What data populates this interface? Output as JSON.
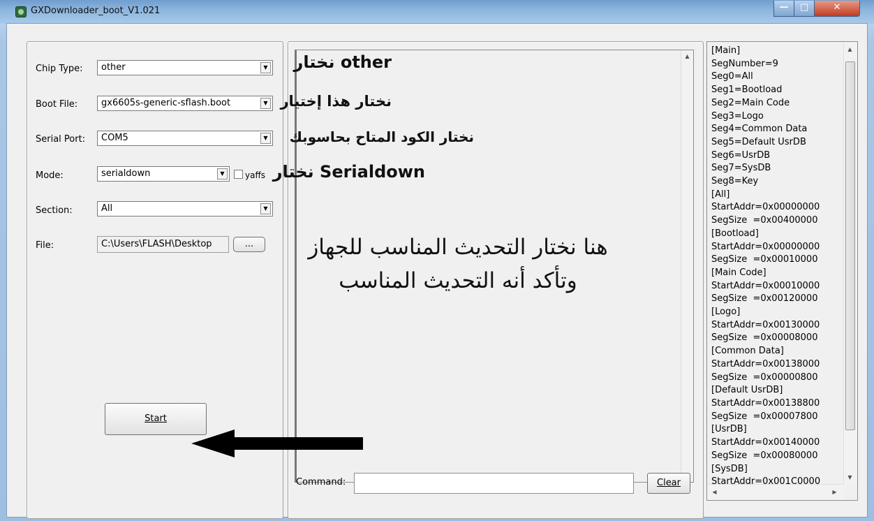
{
  "window": {
    "title": "GXDownloader_boot_V1.021"
  },
  "form": {
    "chip_type": {
      "label": "Chip Type:",
      "value": "other"
    },
    "boot_file": {
      "label": "Boot File:",
      "value": "gx6605s-generic-sflash.boot"
    },
    "serial_port": {
      "label": "Serial Port:",
      "value": "COM5"
    },
    "mode": {
      "label": "Mode:",
      "value": "serialdown",
      "yaffs_label": "yaffs"
    },
    "section": {
      "label": "Section:",
      "value": "All"
    },
    "file": {
      "label": "File:",
      "value": "C:\\Users\\FLASH\\Desktop",
      "browse_label": "..."
    },
    "start_label": "Start"
  },
  "command": {
    "label": "Command:",
    "value": "",
    "clear_label": "Clear"
  },
  "ini_lines": [
    "[Main]",
    "SegNumber=9",
    "Seg0=All",
    "Seg1=Bootload",
    "Seg2=Main Code",
    "Seg3=Logo",
    "Seg4=Common Data",
    "Seg5=Default UsrDB",
    "Seg6=UsrDB",
    "Seg7=SysDB",
    "Seg8=Key",
    "[All]",
    "StartAddr=0x00000000",
    "SegSize  =0x00400000",
    "[Bootload]",
    "StartAddr=0x00000000",
    "SegSize  =0x00010000",
    "[Main Code]",
    "StartAddr=0x00010000",
    "SegSize  =0x00120000",
    "[Logo]",
    "StartAddr=0x00130000",
    "SegSize  =0x00008000",
    "[Common Data]",
    "StartAddr=0x00138000",
    "SegSize  =0x00000800",
    "[Default UsrDB]",
    "StartAddr=0x00138800",
    "SegSize  =0x00007800",
    "[UsrDB]",
    "StartAddr=0x00140000",
    "SegSize  =0x00080000",
    "[SysDB]",
    "StartAddr=0x001C0000"
  ],
  "annotations": {
    "chip": "نختار other",
    "boot": "نختار هذا إختيار",
    "port": "نختار الكود المتاح بحاسوبك",
    "mode": "نختار Serialdown",
    "file_line1": "هنا نختار التحديث المناسب للجهاز",
    "file_line2": "وتأكد أنه التحديث المناسب"
  }
}
